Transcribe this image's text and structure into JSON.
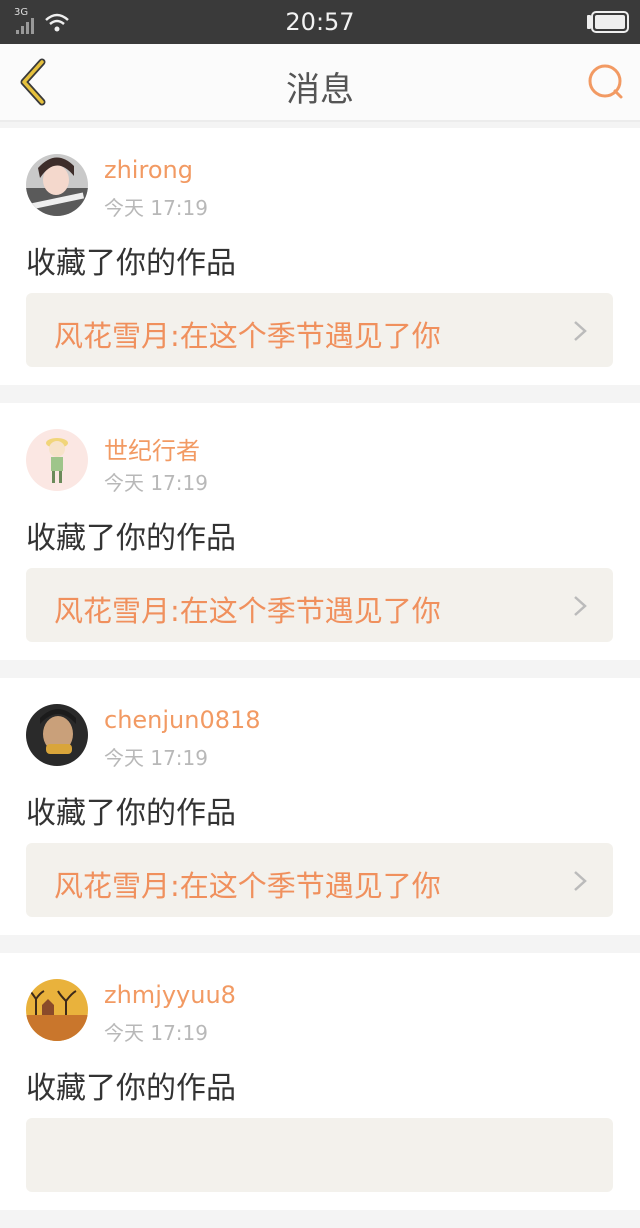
{
  "status_bar": {
    "network": "3G",
    "time": "20:57"
  },
  "nav": {
    "title": "消息"
  },
  "messages": [
    {
      "username": "zhirong",
      "time": "今天 17:19",
      "action": "收藏了你的作品",
      "work_title": "风花雪月:在这个季节遇见了你"
    },
    {
      "username": "世纪行者",
      "time": "今天 17:19",
      "action": "收藏了你的作品",
      "work_title": "风花雪月:在这个季节遇见了你"
    },
    {
      "username": "chenjun0818",
      "time": "今天 17:19",
      "action": "收藏了你的作品",
      "work_title": "风花雪月:在这个季节遇见了你"
    },
    {
      "username": "zhmjyyuu8",
      "time": "今天 17:19",
      "action": "收藏了你的作品",
      "work_title": ""
    }
  ],
  "colors": {
    "accent": "#f29a63",
    "status_bar_bg": "#3a3a3a",
    "back_arrow": "#e6c13d"
  }
}
